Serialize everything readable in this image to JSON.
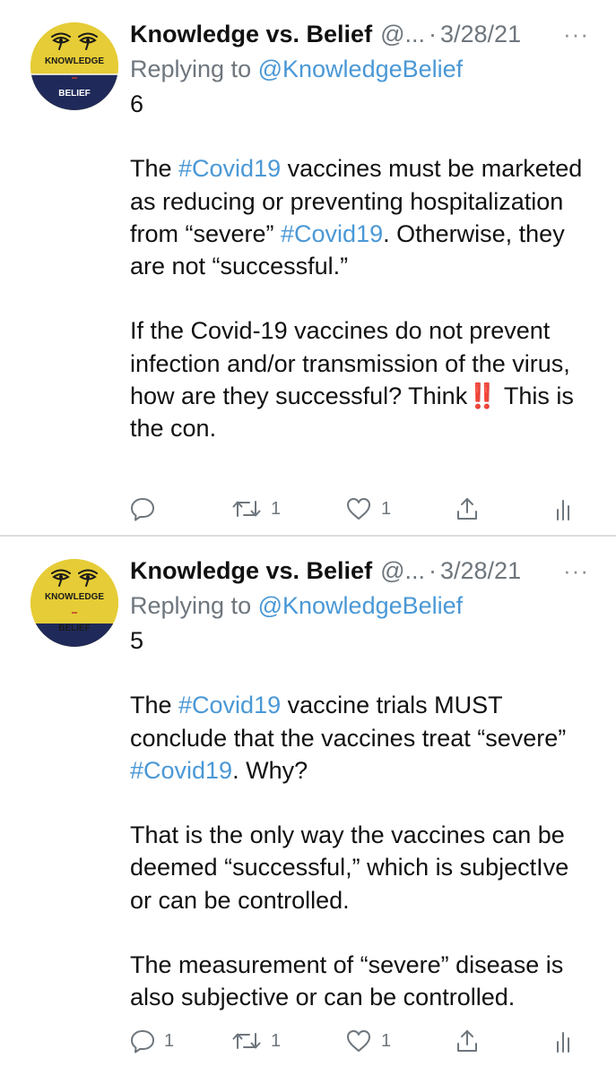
{
  "tweets": [
    {
      "author_name": "Knowledge vs. Belief",
      "handle": "@...",
      "separator": "·",
      "date": "3/28/21",
      "more_icon": "more-options-icon",
      "reply_prefix": "Replying to",
      "reply_to": "@KnowledgeBelief",
      "avatar": {
        "top_text": "KNOWLEDGE",
        "bottom_text": "BELIEF",
        "top_color": "#e6cc36",
        "bottom_color": "#1f2a5a"
      },
      "number": "6",
      "p2": {
        "a": "The ",
        "tag1": "#Covid19",
        "b": " vaccines must be marketed as reducing or preventing hospitalization from “severe” ",
        "tag2": "#Covid19",
        "c": ". Otherwise, they are not “successful.”"
      },
      "p3": {
        "a": "If the Covid-19 vaccines do not prevent infection and/or transmission of the virus, how are they successful? Think",
        "emoji": "‼️",
        "b": " This is the con."
      },
      "actions": {
        "reply_count": "",
        "retweet_count": "1",
        "like_count": "1"
      }
    },
    {
      "author_name": "Knowledge vs. Belief",
      "handle": "@...",
      "separator": "·",
      "date": "3/28/21",
      "more_icon": "more-options-icon",
      "reply_prefix": "Replying to",
      "reply_to": "@KnowledgeBelief",
      "avatar": {
        "top_text": "KNOWLEDGE",
        "bottom_text": "BELIEF",
        "top_color": "#e6cc36",
        "bottom_color": "#1f2a5a"
      },
      "number": "5",
      "p2": {
        "a": "The ",
        "tag1": "#Covid19",
        "b": " vaccine trials MUST conclude that the vaccines treat “severe” ",
        "tag2": "#Covid19",
        "c": ". Why?"
      },
      "p3": "That is the only way the vaccines can be deemed “successful,” which is subjectIve or can be controlled.",
      "p4": "The measurement of “severe” disease is also subjective or can be controlled.",
      "actions": {
        "reply_count": "1",
        "retweet_count": "1",
        "like_count": "1"
      }
    }
  ],
  "colors": {
    "link": "#4a98d6",
    "muted": "#6e767d",
    "divider": "#dcdcdc"
  }
}
